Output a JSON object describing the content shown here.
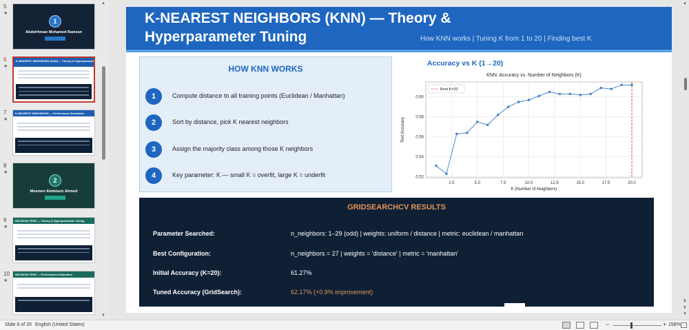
{
  "thumbnails": [
    {
      "number": "5",
      "name": "Abdelrhman Mohamed Ramzan",
      "circle": "1",
      "tag": "KNN Classifier"
    },
    {
      "number": "6",
      "header": "K-NEAREST NEIGHBORS (KNN) — Theory & Hyperparameter Tuning",
      "selected": true
    },
    {
      "number": "7",
      "header": "K-NEAREST NEIGHBORS — Performance Evaluation"
    },
    {
      "number": "8",
      "name": "Moemen Abdelaziz Ahmed",
      "circle": "2",
      "tag": "Decision Tree Classifier"
    },
    {
      "number": "9",
      "header": "DECISION TREE — Theory & Hyperparameter Tuning"
    },
    {
      "number": "10",
      "header": "DECISION TREE — Performance Evaluation"
    }
  ],
  "slide": {
    "title_line1": "K-NEAREST NEIGHBORS (KNN) — Theory &",
    "title_line2": "Hyperparameter Tuning",
    "subtitle": "How KNN works  |  Tuning K from 1 to 20  |  Finding best K",
    "how": {
      "title": "HOW KNN WORKS",
      "steps": [
        {
          "num": "1",
          "text": "Compute distance to all training points (Euclidean / Manhattan)"
        },
        {
          "num": "2",
          "text": "Sort by distance, pick K nearest neighbors"
        },
        {
          "num": "3",
          "text": "Assign the majority class among those K neighbors"
        },
        {
          "num": "4",
          "text": "Key parameter: K — small K = overfit, large K = underfit"
        }
      ]
    },
    "chart_heading": "Accuracy vs K (1→20)",
    "results": {
      "title": "GRIDSEARCHCV RESULTS",
      "rows": [
        {
          "label": "Parameter Searched:",
          "value": "n_neighbors: 1–29 (odd)  |  weights: uniform / distance  |  metric: euclidean / manhattan",
          "accent": false
        },
        {
          "label": "Best Configuration:",
          "value": "n_neighbors = 27  |  weights = 'distance'  |  metric = 'manhattan'",
          "accent": false
        },
        {
          "label": "Initial Accuracy (K=20):",
          "value": "61.27%",
          "accent": false
        },
        {
          "label": "Tuned Accuracy (GridSearch):",
          "value": "62.17%  (+0.9% improvement)",
          "accent": true
        }
      ]
    }
  },
  "chart_data": {
    "type": "line",
    "title": "KNN: Accuracy vs. Number of Neighbors (K)",
    "xlabel": "K (Number of Neighbors)",
    "ylabel": "Test Accuracy",
    "xlim": [
      0,
      21
    ],
    "ylim": [
      0.519,
      0.615
    ],
    "xticks": [
      2.5,
      5.0,
      7.5,
      10.0,
      12.5,
      15.0,
      17.5,
      20.0
    ],
    "yticks": [
      0.52,
      0.54,
      0.56,
      0.58,
      0.6
    ],
    "x": [
      1,
      2,
      3,
      4,
      5,
      6,
      7,
      8,
      9,
      10,
      11,
      12,
      13,
      14,
      15,
      16,
      17,
      18,
      19,
      20
    ],
    "y": [
      0.531,
      0.523,
      0.563,
      0.564,
      0.575,
      0.572,
      0.582,
      0.59,
      0.595,
      0.597,
      0.601,
      0.605,
      0.603,
      0.603,
      0.602,
      0.603,
      0.609,
      0.608,
      0.612,
      0.612
    ],
    "best_k": 20,
    "legend": "Best K=20",
    "legend_position": "top-left",
    "grid": true,
    "colors": {
      "line": "#4a86c8",
      "best": "#d9534f"
    }
  },
  "status": {
    "slide_info": "Slide 6 of 20",
    "language": "English (United States)",
    "zoom": "158%"
  },
  "colors": {
    "title_bar": "#1e66bf",
    "results_bg": "#0f2035",
    "accent": "#e0955a"
  }
}
